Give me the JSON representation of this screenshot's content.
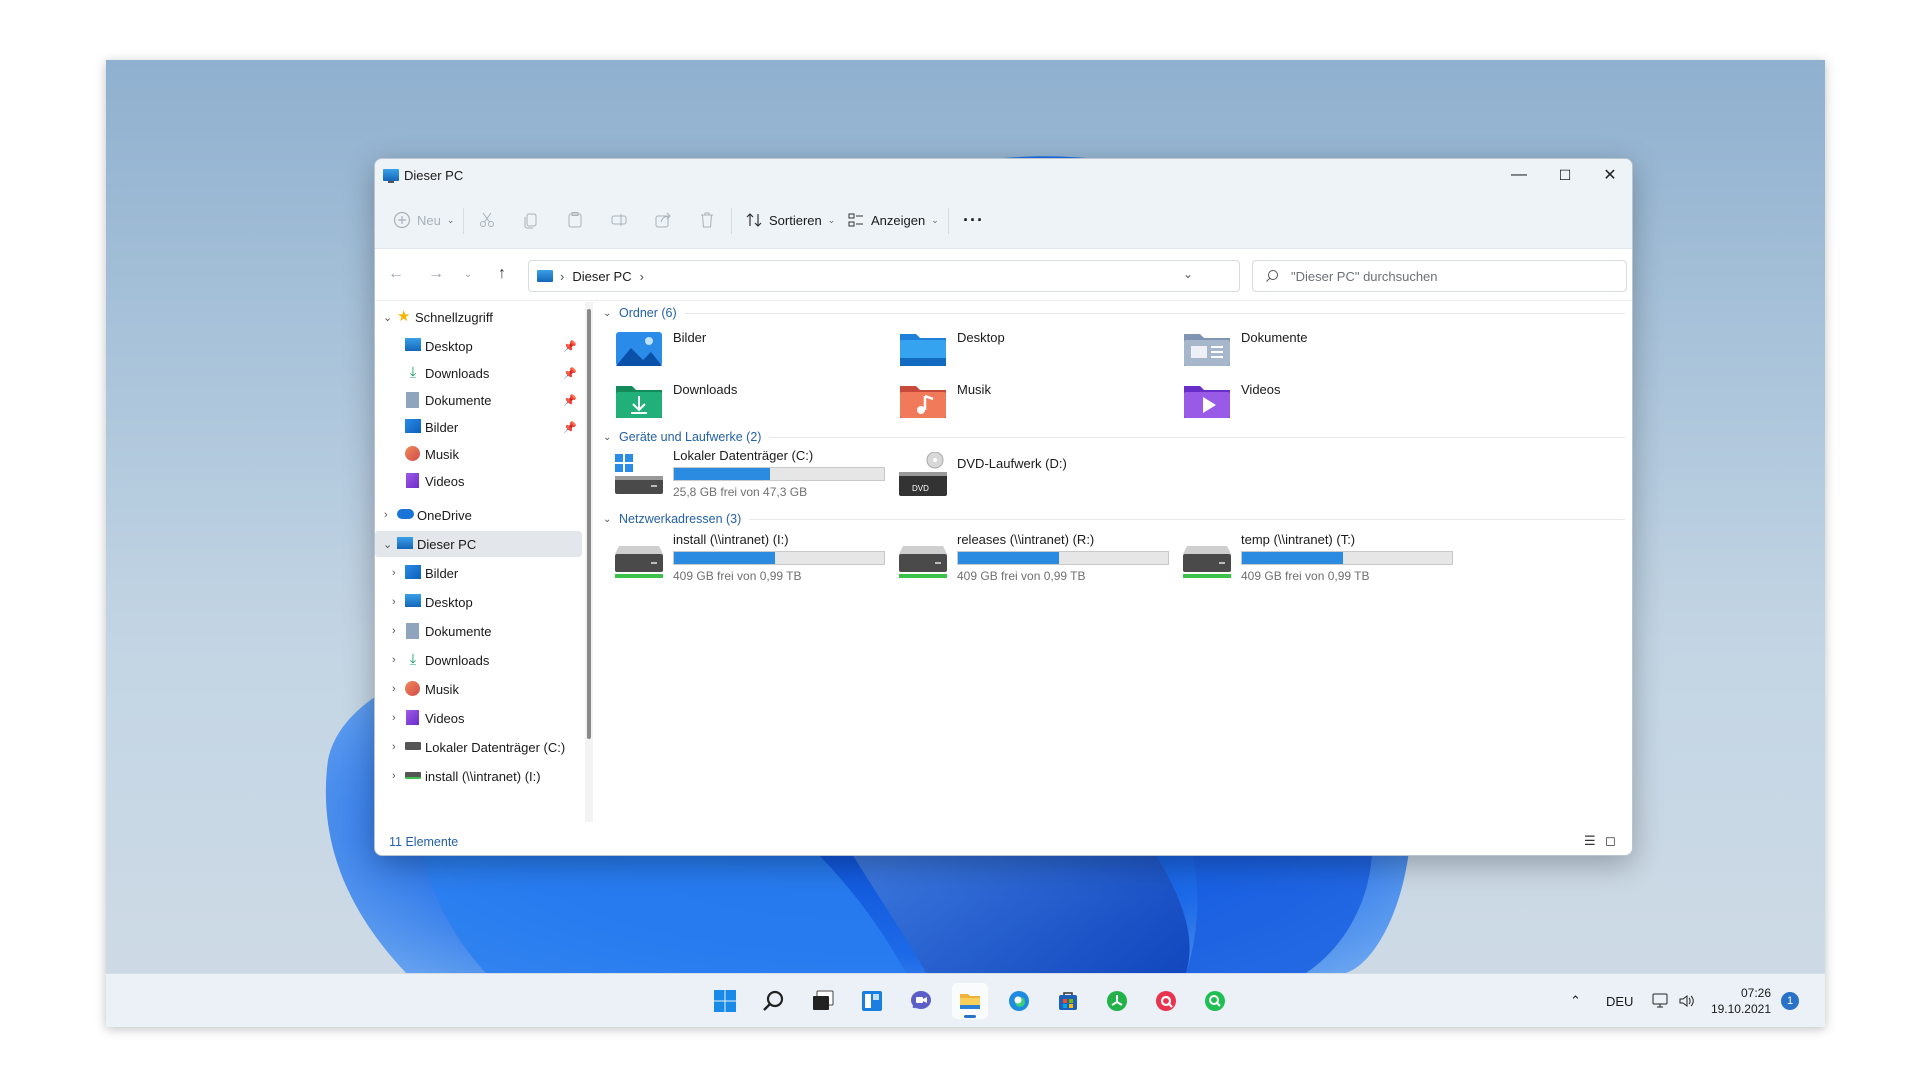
{
  "window": {
    "title": "Dieser PC",
    "controls": {
      "minimize": "—",
      "maximize": "☐",
      "close": "✕"
    }
  },
  "toolbar": {
    "new_label": "Neu",
    "sort_label": "Sortieren",
    "view_label": "Anzeigen",
    "more_label": "···"
  },
  "address": {
    "crumb": "Dieser PC",
    "separator": "›",
    "search_placeholder": "\"Dieser PC\" durchsuchen"
  },
  "sidebar": {
    "quick_access": {
      "label": "Schnellzugriff",
      "items": [
        {
          "label": "Desktop",
          "icon": "desktop-icon",
          "pinned": true
        },
        {
          "label": "Downloads",
          "icon": "download-icon",
          "pinned": true
        },
        {
          "label": "Dokumente",
          "icon": "document-icon",
          "pinned": true
        },
        {
          "label": "Bilder",
          "icon": "pictures-icon",
          "pinned": true
        },
        {
          "label": "Musik",
          "icon": "music-icon",
          "pinned": false
        },
        {
          "label": "Videos",
          "icon": "video-icon",
          "pinned": false
        }
      ]
    },
    "onedrive": {
      "label": "OneDrive"
    },
    "this_pc": {
      "label": "Dieser PC",
      "items": [
        {
          "label": "Bilder",
          "icon": "pictures-icon"
        },
        {
          "label": "Desktop",
          "icon": "desktop-icon"
        },
        {
          "label": "Dokumente",
          "icon": "document-icon"
        },
        {
          "label": "Downloads",
          "icon": "download-icon"
        },
        {
          "label": "Musik",
          "icon": "music-icon"
        },
        {
          "label": "Videos",
          "icon": "video-icon"
        },
        {
          "label": "Lokaler Datenträger (C:)",
          "icon": "drive-icon"
        },
        {
          "label": "install (\\\\intranet) (I:)",
          "icon": "network-drive-icon"
        }
      ]
    }
  },
  "content": {
    "folders_group": "Ordner (6)",
    "folders": [
      {
        "label": "Bilder",
        "icon": "pictures-folder-icon"
      },
      {
        "label": "Desktop",
        "icon": "desktop-folder-icon"
      },
      {
        "label": "Dokumente",
        "icon": "documents-folder-icon"
      },
      {
        "label": "Downloads",
        "icon": "downloads-folder-icon"
      },
      {
        "label": "Musik",
        "icon": "music-folder-icon"
      },
      {
        "label": "Videos",
        "icon": "videos-folder-icon"
      }
    ],
    "devices_group": "Geräte und Laufwerke (2)",
    "devices": [
      {
        "label": "Lokaler Datenträger (C:)",
        "free": "25,8 GB frei von 47,3 GB",
        "used_fraction": 0.455
      },
      {
        "label": "DVD-Laufwerk (D:)",
        "badge": "DVD"
      }
    ],
    "network_group": "Netzwerkadressen (3)",
    "network": [
      {
        "label": "install (\\\\intranet) (I:)",
        "free": "409 GB frei von 0,99 TB",
        "used_fraction": 0.48
      },
      {
        "label": "releases (\\\\intranet) (R:)",
        "free": "409 GB frei von 0,99 TB",
        "used_fraction": 0.48
      },
      {
        "label": "temp (\\\\intranet) (T:)",
        "free": "409 GB frei von 0,99 TB",
        "used_fraction": 0.48
      }
    ]
  },
  "status": {
    "count": "11 Elemente"
  },
  "taskbar": {
    "apps": [
      "start-icon",
      "search-icon",
      "task-view-icon",
      "widgets-icon",
      "teams-chat-icon",
      "file-explorer-icon",
      "edge-icon",
      "store-icon",
      "green-app-icon",
      "red-app-icon",
      "green-search-app-icon"
    ],
    "language": "DEU",
    "time": "07:26",
    "date": "19.10.2021",
    "notifications": "1"
  },
  "colors": {
    "accent": "#2b8be0",
    "link": "#2461a8",
    "taskbar": "#ecf1f7"
  }
}
